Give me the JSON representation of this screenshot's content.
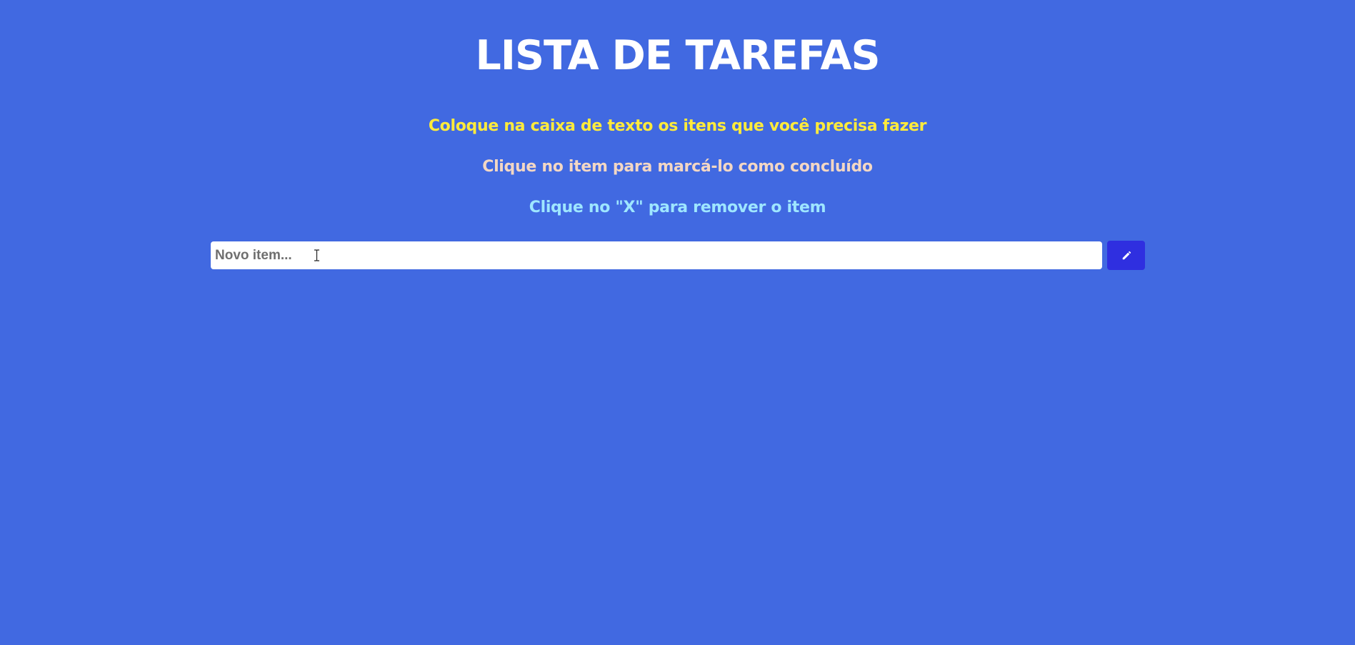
{
  "header": {
    "title": "LISTA DE TAREFAS"
  },
  "instructions": {
    "line1": "Coloque na caixa de texto os itens que você precisa fazer",
    "line2": "Clique no item para marcá-lo como concluído",
    "line3": "Clique no \"X\" para remover o item"
  },
  "form": {
    "input_placeholder": "Novo item...",
    "input_value": "",
    "add_button_icon": "pencil-icon"
  },
  "colors": {
    "background": "#4169e1",
    "title": "#ffffff",
    "line1": "#ffeb3b",
    "line2": "#f3d7c4",
    "line3": "#9ee6ff",
    "button": "#2f2fe0"
  }
}
